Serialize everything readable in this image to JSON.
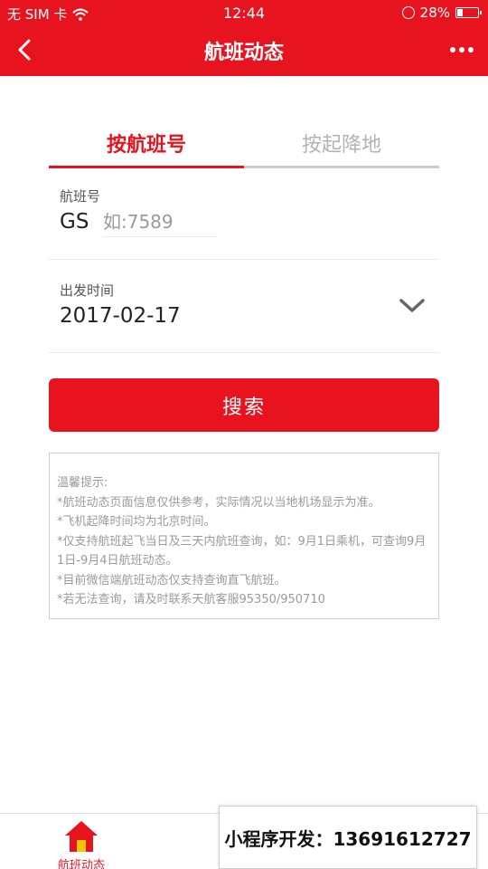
{
  "status_bar": {
    "carrier": "无 SIM 卡",
    "time": "12:44",
    "battery": "28%",
    "battery_level": 0.28
  },
  "navbar": {
    "title": "航班动态",
    "back_icon": "chevron-left-icon",
    "more_icon": "more-dots-icon"
  },
  "tabs": [
    {
      "label": "按航班号",
      "active": true
    },
    {
      "label": "按起降地",
      "active": false
    }
  ],
  "flight_field": {
    "label": "航班号",
    "prefix": "GS",
    "value": "",
    "placeholder": "如:7589"
  },
  "date_field": {
    "label": "出发时间",
    "value": "2017-02-17",
    "icon": "chevron-down-icon"
  },
  "search_button": {
    "label": "搜索"
  },
  "tips": {
    "title": "温馨提示:",
    "lines": [
      "*航班动态页面信息仅供参考，实际情况以当地机场显示为准。",
      "*飞机起降时间均为北京时间。",
      "*仅支持航班起飞当日及三天内航班查询，如：9月1日乘机，可查询9月1日-9月4日航班动态。",
      "*目前微信端航班动态仅支持查询直飞航班。",
      "*若无法查询，请及时联系天航客服95350/950710"
    ]
  },
  "tabbar": {
    "home_label": "航班动态",
    "home_icon": "home-icon"
  },
  "watermark": {
    "text": "小程序开发：13691612727"
  },
  "colors": {
    "brand_red": "#e7141f",
    "inactive_tab": "#b3b3b3",
    "tip_text": "#9a9a9a"
  }
}
